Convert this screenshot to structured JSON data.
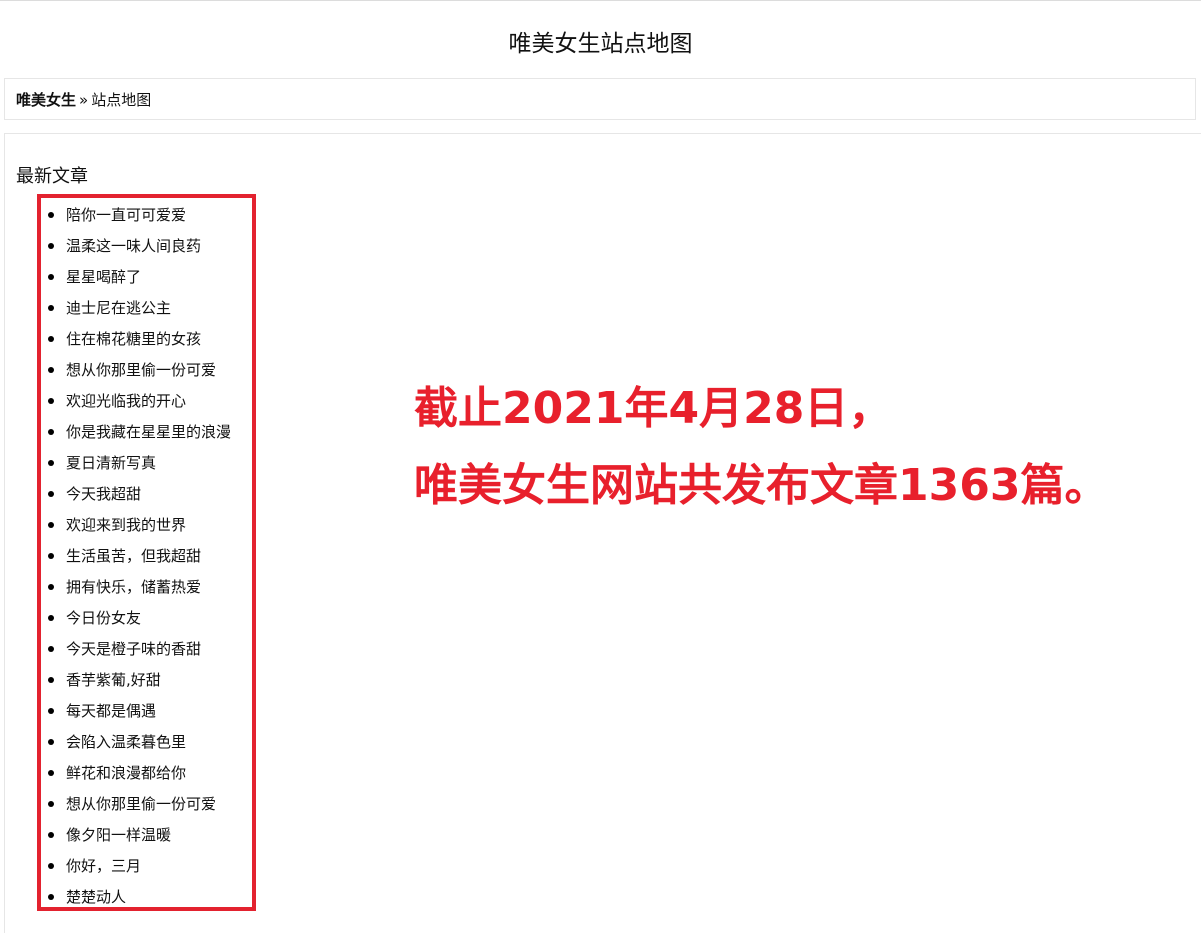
{
  "header": {
    "site_title": "唯美女生站点地图"
  },
  "breadcrumb": {
    "home": "唯美女生",
    "separator": "»",
    "current": "站点地图"
  },
  "section": {
    "heading": "最新文章"
  },
  "posts": [
    "陪你一直可可爱爱",
    "温柔这一味人间良药",
    "星星喝醉了",
    "迪士尼在逃公主",
    "住在棉花糖里的女孩",
    "想从你那里偷一份可爱",
    "欢迎光临我的开心",
    "你是我藏在星星里的浪漫",
    "夏日清新写真",
    "今天我超甜",
    "欢迎来到我的世界",
    "生活虽苦，但我超甜",
    "拥有快乐，储蓄热爱",
    "今日份女友",
    "今天是橙子味的香甜",
    "香芋紫葡,好甜",
    "每天都是偶遇",
    "会陷入温柔暮色里",
    "鲜花和浪漫都给你",
    "想从你那里偷一份可爱",
    "像夕阳一样温暖",
    "你好，三月",
    "楚楚动人"
  ],
  "annotation": {
    "line1": "截止2021年4月28日，",
    "line2": "唯美女生网站共发布文章1363篇。",
    "color": "#e8202c"
  },
  "highlight": {
    "border_color": "#e3222f"
  }
}
